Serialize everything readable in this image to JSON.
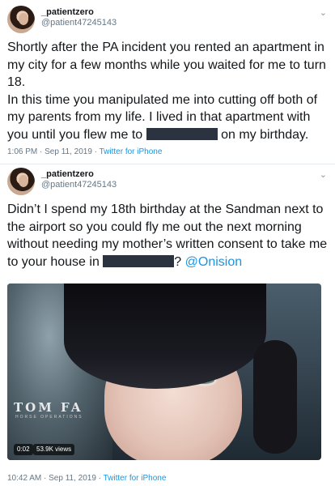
{
  "tweets": [
    {
      "display_name": "_patientzero",
      "handle": "@patient47245143",
      "text_part1": "Shortly after the PA incident you rented an apartment in my city for a few months while you waited for me to turn 18.\nIn this time you manipulated me into cutting off both of my parents from my life. I lived in that apartment with you until you flew me to ",
      "text_part2": " on my birthday.",
      "timestamp": "1:06 PM · Sep 11, 2019 · ",
      "source": "Twitter for iPhone"
    },
    {
      "display_name": "_patientzero",
      "handle": "@patient47245143",
      "text_part1": "Didn’t I spend my 18th birthday at the Sandman next to the airport so you could fly me out the next morning without needing my mother’s written consent to take me to your house in ",
      "text_part2": "? ",
      "mention": "@Onision",
      "timestamp": "10:42 AM · Sep 11, 2019 · ",
      "source": "Twitter for iPhone",
      "video": {
        "duration": "0:02",
        "views": "53.9K views",
        "overlay_title": "TOM FA",
        "overlay_subtitle": "HORSE OPERATIONS"
      }
    }
  ],
  "icons": {
    "menu": "chevron-down-icon"
  },
  "colors": {
    "link": "#1b95e0",
    "text": "#14171a",
    "muted": "#657786"
  }
}
